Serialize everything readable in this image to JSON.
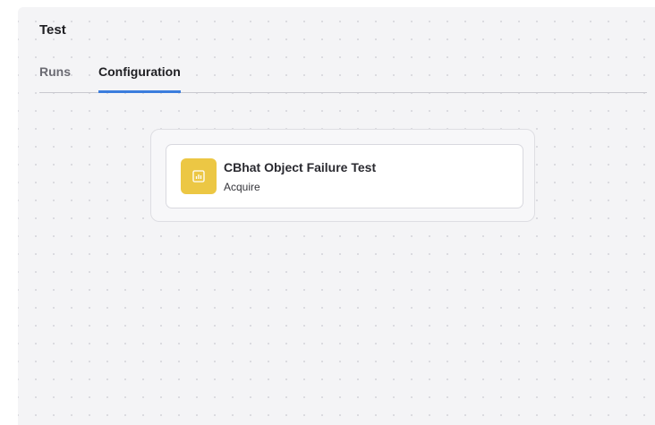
{
  "page": {
    "title": "Test"
  },
  "tabs": [
    {
      "label": "Runs",
      "active": false
    },
    {
      "label": "Configuration",
      "active": true
    }
  ],
  "node": {
    "title": "CBhat Object Failure Test",
    "subtitle": "Acquire",
    "icon": "chart-icon",
    "icon_color": "#ecc744"
  },
  "colors": {
    "accent": "#3b7ddd",
    "background": "#f4f4f6"
  }
}
